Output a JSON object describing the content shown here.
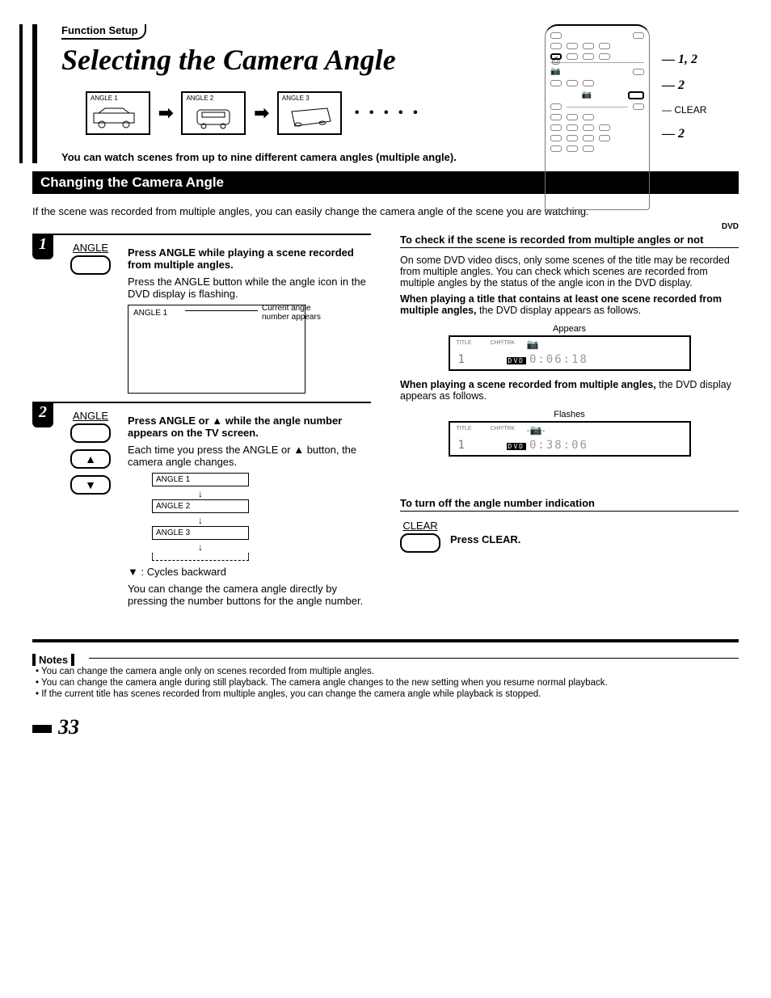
{
  "header": {
    "breadcrumb": "Function Setup",
    "title": "Selecting the Camera Angle",
    "multi_angle_text": "You can watch scenes from up to nine different camera angles (multiple angle)."
  },
  "angles": {
    "box1": "ANGLE 1",
    "box2": "ANGLE 2",
    "box3": "ANGLE 3",
    "dots": "• • • • •"
  },
  "remote": {
    "c1": "1, 2",
    "c2": "2",
    "c_clear": "CLEAR",
    "c3": "2",
    "dvd": "DVD"
  },
  "section": {
    "changing": "Changing the Camera Angle",
    "intro": "If the scene was recorded from multiple angles, you can easily change the camera angle of the scene you are watching."
  },
  "step1": {
    "num": "1",
    "key": "ANGLE",
    "head": "Press ANGLE while playing a scene recorded from multiple angles.",
    "body": "Press the ANGLE button while the angle icon in the DVD display is flashing.",
    "disp": "ANGLE 1",
    "callout": "Current angle number appears"
  },
  "step2": {
    "num": "2",
    "key": "ANGLE",
    "head_a": "Press ANGLE or ",
    "head_b": " while the angle number appears on the TV screen.",
    "body_a": "Each time you press the ANGLE or ",
    "body_b": " button, the camera angle changes.",
    "a1": "ANGLE 1",
    "a2": "ANGLE 2",
    "a3": "ANGLE 3",
    "cycles": " : Cycles backward",
    "tail": "You can change the camera angle directly by pressing the number buttons for the angle number."
  },
  "right": {
    "h1": "To check if the scene is recorded from multiple angles or not",
    "p1": "On some DVD video discs, only some scenes of the title may be recorded from multiple angles. You can check which scenes are recorded from multiple angles by the status of the angle icon in the DVD display.",
    "p2a": "When playing a title that contains at least one scene recorded from multiple angles,",
    "p2b": " the DVD display appears as follows.",
    "appears": "Appears",
    "disp1_title": "TITLE",
    "disp1_chp": "CHP/TRK",
    "disp1_num": "1",
    "disp1_badge": "DVD",
    "disp1_time": "0:06:18",
    "p3a": "When playing a scene recorded from multiple angles,",
    "p3b": " the DVD display appears as follows.",
    "flashes": "Flashes",
    "disp2_time": "0:38:06",
    "h2": "To turn off the angle number indication",
    "clear_key": "CLEAR",
    "clear_inst": "Press CLEAR."
  },
  "notes": {
    "label": "Notes",
    "n1": "• You can change the camera angle only on scenes recorded from multiple angles.",
    "n2": "• You can change the camera angle during still playback. The camera angle changes to the new setting when you resume normal playback.",
    "n3": "• If the current title has scenes recorded from multiple angles, you can change the camera angle while playback is stopped."
  },
  "page": "33"
}
